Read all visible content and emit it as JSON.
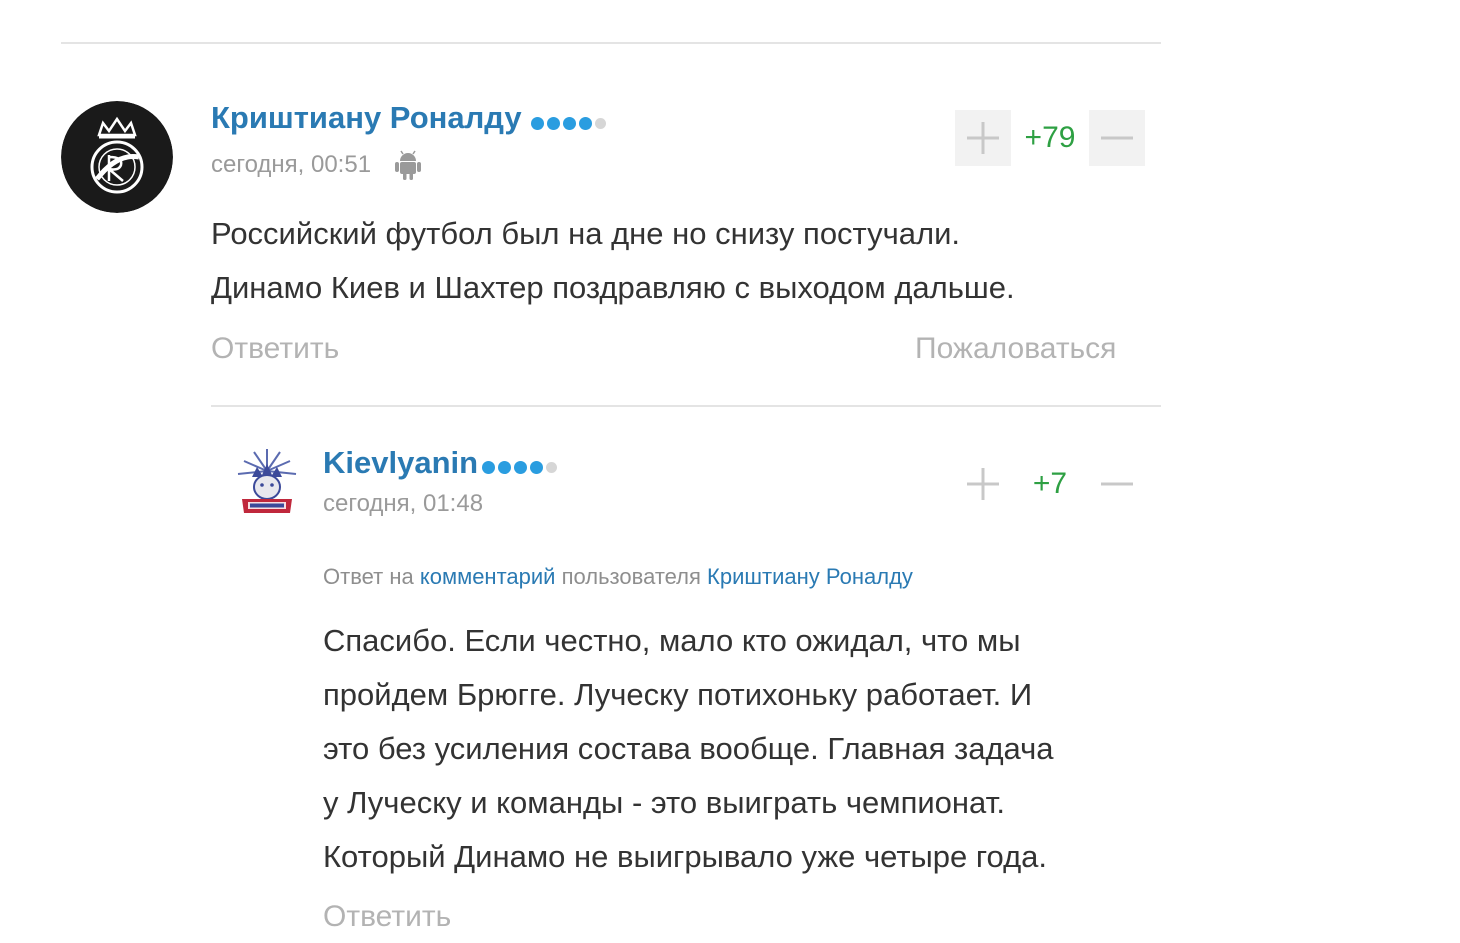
{
  "comments": [
    {
      "author": "Криштиану Роналду",
      "rating": {
        "filled": 4,
        "total": 5,
        "filled_color": "#2a9de0",
        "empty_color": "#d6d6d6"
      },
      "timestamp": "сегодня, 00:51",
      "device_icon": "android-icon",
      "avatar_icon": "real-madrid-crest-icon",
      "score": "+79",
      "text_lines": [
        "Российский футбол был на дне но снизу постучали.",
        "Динамо Киев и Шахтер поздравляю с выходом дальше."
      ],
      "reply_label": "Ответить",
      "report_label": "Пожаловаться"
    },
    {
      "author": "Kievlyanin",
      "rating": {
        "filled": 4,
        "total": 5,
        "filled_color": "#2a9de0",
        "empty_color": "#d6d6d6"
      },
      "timestamp": "сегодня, 01:48",
      "avatar_icon": "statue-of-liberty-logo-icon",
      "score": "+7",
      "reply_to": {
        "prefix": "Ответ на",
        "comment_link": "комментарий",
        "middle": "пользователя",
        "user_link": "Криштиану Роналду"
      },
      "text_lines": [
        "Спасибо. Если честно, мало кто ожидал, что мы",
        "пройдем Брюгге. Луческу потихоньку работает. И",
        "это без усиления состава вообще. Главная задача",
        "у Луческу и команды - это выиграть чемпионат.",
        "Который Динамо не выигрывало уже четыре года."
      ],
      "reply_label": "Ответить"
    }
  ],
  "colors": {
    "link_blue": "#2a7ab3",
    "score_green": "#2ea043",
    "muted_gray": "#9a9a9a",
    "text_dark": "#333333",
    "divider": "#e4e4e4"
  }
}
